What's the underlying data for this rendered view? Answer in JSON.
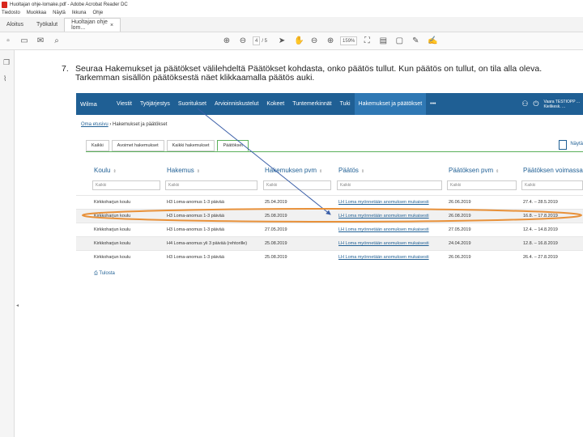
{
  "app": {
    "title": "Huoltajan ohje-lomake.pdf - Adobe Acrobat Reader DC",
    "menu": [
      "Tiedosto",
      "Muokkaa",
      "Näytä",
      "Ikkuna",
      "Ohje"
    ],
    "tabs": {
      "home": "Aloitus",
      "tools": "Työkalut",
      "document": "Huoltajan ohje lom..."
    },
    "toolbar": {
      "page_current": "4",
      "page_total": "/ 5",
      "zoom": "159%"
    }
  },
  "instruction": {
    "number": "7.",
    "text": "Seuraa Hakemukset ja päätökset välilehdeltä Päätökset kohdasta, onko päätös tullut. Kun päätös on tullut, on tila alla oleva. Tarkemman sisällön päätöksestä näet klikkaamalla päätös auki."
  },
  "wilma": {
    "nav": [
      "Wilma",
      "Viestit",
      "Työjärjestys",
      "Suoritukset",
      "Arvioinniskustelut",
      "Kokeet",
      "Tuntemerkinnät",
      "Tuki",
      "Hakemukset ja päätökset",
      "•••"
    ],
    "user_line1": "Vaara TESTIOPP ...",
    "user_line2": "Kielikesk. ...",
    "breadcrumb": {
      "link": "Oma etusivu",
      "rest": " › Hakemukset ja päätökset"
    },
    "tabs": [
      "Kaikki",
      "Avoimet hakemukset",
      "Kaikki hakemukset",
      "Päätökset"
    ],
    "view_select": "Näytä",
    "columns": [
      "Koulu",
      "Hakemus",
      "Hakemuksen pvm",
      "Päätös",
      "Päätöksen pvm",
      "Päätöksen voimassaolo"
    ],
    "filter_placeholder": "Kaikki",
    "rows": [
      [
        "Kirkkoharjun koulu",
        "H3 Loma-anomus 1-3 päivää",
        "25.04.2019",
        "LH Loma myönnetään anomuksen mukaisesti",
        "26.06.2019",
        "27.4. – 28.5.2019"
      ],
      [
        "Kirkkoharjun koulu",
        "H3 Loma-anomus 1-3 päivää",
        "25.08.2019",
        "LH Loma myönnetään anomuksen mukaisesti",
        "26.08.2019",
        "16.8. – 17.8.2019"
      ],
      [
        "Kirkkoharjun koulu",
        "H3 Loma-anomus 1-3 päivää",
        "27.05.2019",
        "LH Loma myönnetään anomuksen mukaisesti",
        "27.05.2019",
        "12.4. – 14.8.2019"
      ],
      [
        "Kirkkoharjun koulu",
        "H4 Loma-anomus yli 3 päivää (rehtorille)",
        "25.08.2019",
        "LH Loma myönnetään anomuksen mukaisesti",
        "24.04.2019",
        "12.8. – 16.8.2019"
      ],
      [
        "Kirkkoharjun koulu",
        "H3 Loma-anomus 1-3 päivää",
        "25.08.2019",
        "LH Loma myönnetään anomuksen mukaisesti",
        "26.06.2019",
        "26.4. – 27.8.2019"
      ]
    ],
    "back": "Tulosta"
  },
  "colors": {
    "wilma_nav": "#1f5f94",
    "highlight": "#e8913a",
    "arrow": "#3b5fa8",
    "tab_active": "#5bb05b"
  }
}
